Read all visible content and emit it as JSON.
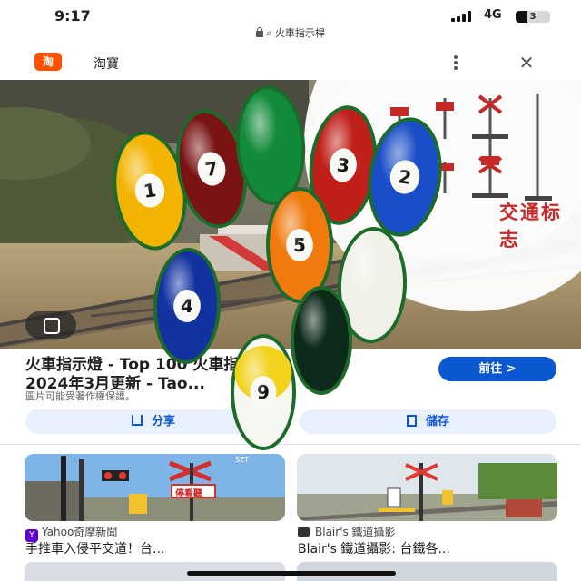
{
  "status_bar": {
    "time": "9:17",
    "network": "4G",
    "battery": "3"
  },
  "url_bar": {
    "text": "火車指示桿"
  },
  "app_header": {
    "logo_text": "淘",
    "app_name": "淘寶"
  },
  "hero": {
    "sign_caption": "交通标志"
  },
  "result": {
    "title_line1": "火車指示燈 - Top 100 火車指示燈 -",
    "title_line2": "2024年3月更新 - Tao...",
    "copyright_note": "圖片可能受著作權保護。",
    "visit_label": "前往 >",
    "share_label": "分享",
    "save_label": "儲存"
  },
  "related": [
    {
      "source": "Yahoo奇摩新聞",
      "title": "手推車入侵平交道！台...",
      "sign_text": "停看聽",
      "watermark": "SET"
    },
    {
      "source": "Blair's 鐵道攝影",
      "title": "Blair's 鐵道攝影: 台鐵各..."
    }
  ],
  "overlay_balls": [
    "1",
    "7",
    "",
    "3",
    "2",
    "5",
    "",
    "4",
    "",
    "9"
  ],
  "colors": {
    "accent_blue": "#0b57d0",
    "taobao_orange": "#ff5000",
    "button_bg": "#e8f0fe"
  }
}
